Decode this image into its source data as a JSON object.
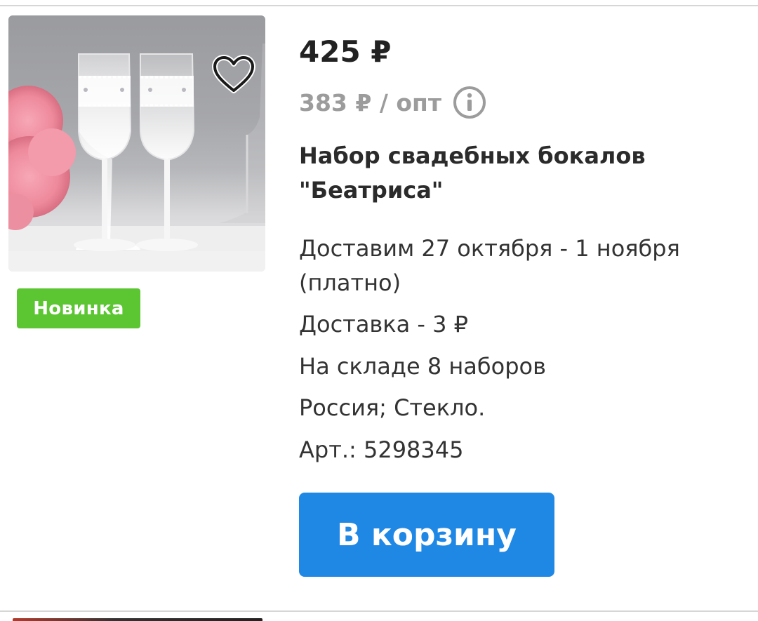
{
  "product": {
    "price": "425 ₽",
    "wholesale_price": "383 ₽ / опт",
    "title": "Набор свадебных бокалов \"Беатриса\"",
    "badge": "Новинка",
    "delivery_dates": "Доставим 27 октября - 1 ноября",
    "delivery_note": "(платно)",
    "delivery_cost": "Доставка - 3 ₽",
    "stock": "На складе 8 наборов",
    "origin": "Россия; Стекло.",
    "article": "Арт.: 5298345",
    "cart_label": "В корзину"
  },
  "icons": {
    "favorite": "heart-icon",
    "info": "info-icon"
  },
  "colors": {
    "badge_green": "#5cc532",
    "button_blue": "#1f88e5",
    "muted_gray": "#9c9c9c"
  }
}
